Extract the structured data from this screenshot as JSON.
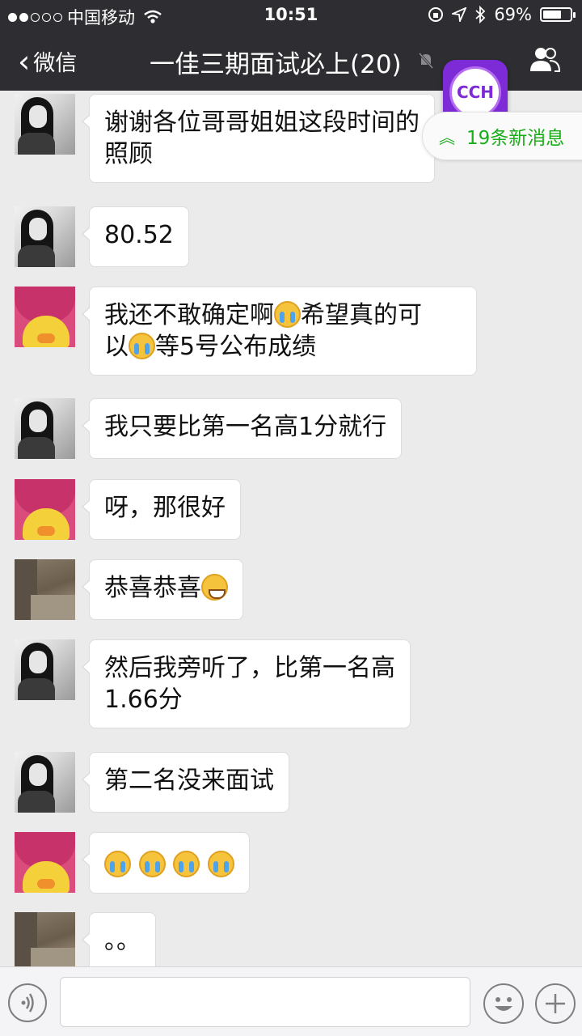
{
  "status_bar": {
    "carrier": "中国移动",
    "time": "10:51",
    "battery": "69%",
    "battery_level": 0.69
  },
  "nav": {
    "back_label": "微信",
    "title": "一佳三期面试必上(20)"
  },
  "floating_app": {
    "label": "CCH"
  },
  "new_messages": {
    "label": "19条新消息"
  },
  "messages": [
    {
      "text_lines": [
        "谢谢各位哥哥姐姐这段时间的",
        "照顾"
      ]
    },
    {
      "text": "80.52"
    },
    {
      "parts": [
        "我还不敢确定啊",
        "希望真的可",
        "以",
        "等5号公布成绩"
      ]
    },
    {
      "text": "我只要比第一名高1分就行"
    },
    {
      "text": "呀，那很好"
    },
    {
      "text": "恭喜恭喜"
    },
    {
      "text_lines": [
        "然后我旁听了，比第一名高",
        "1.66分"
      ]
    },
    {
      "text": "第二名没来面试"
    },
    {
      "text": ""
    },
    {
      "text": "。。"
    }
  ]
}
